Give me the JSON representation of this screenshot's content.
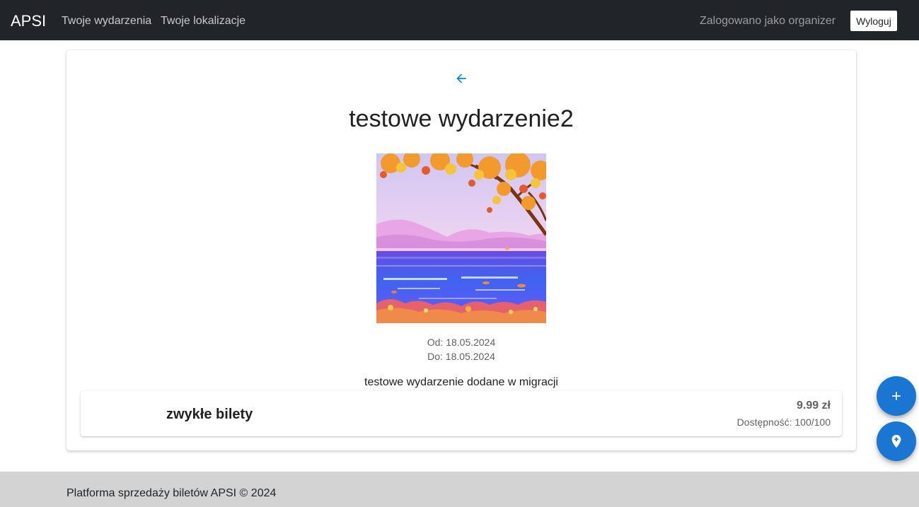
{
  "navbar": {
    "brand": "APSI",
    "links": [
      "Twoje wydarzenia",
      "Twoje lokalizacje"
    ],
    "user_text": "Zalogowano jako organizer",
    "logout_label": "Wyloguj"
  },
  "event": {
    "back_icon": "arrow-left-icon",
    "title": "testowe wydarzenie2",
    "image_alt": "autumn-lake-illustration",
    "date_from": "Od: 18.05.2024",
    "date_to": "Do: 18.05.2024",
    "description": "testowe wydarzenie dodane w migracji"
  },
  "tickets": [
    {
      "name": "zwykłe bilety",
      "price": "9.99 zł",
      "availability": "Dostępność: 100/100"
    }
  ],
  "fabs": {
    "add_icon": "plus-icon",
    "location_icon": "add-location-icon"
  },
  "footer": {
    "text": "Platforma sprzedaży biletów APSI © 2024"
  },
  "colors": {
    "navbar_bg": "#212529",
    "accent": "#1976d2",
    "back_arrow": "#0288d1",
    "footer_bg": "#d3d3d3"
  }
}
